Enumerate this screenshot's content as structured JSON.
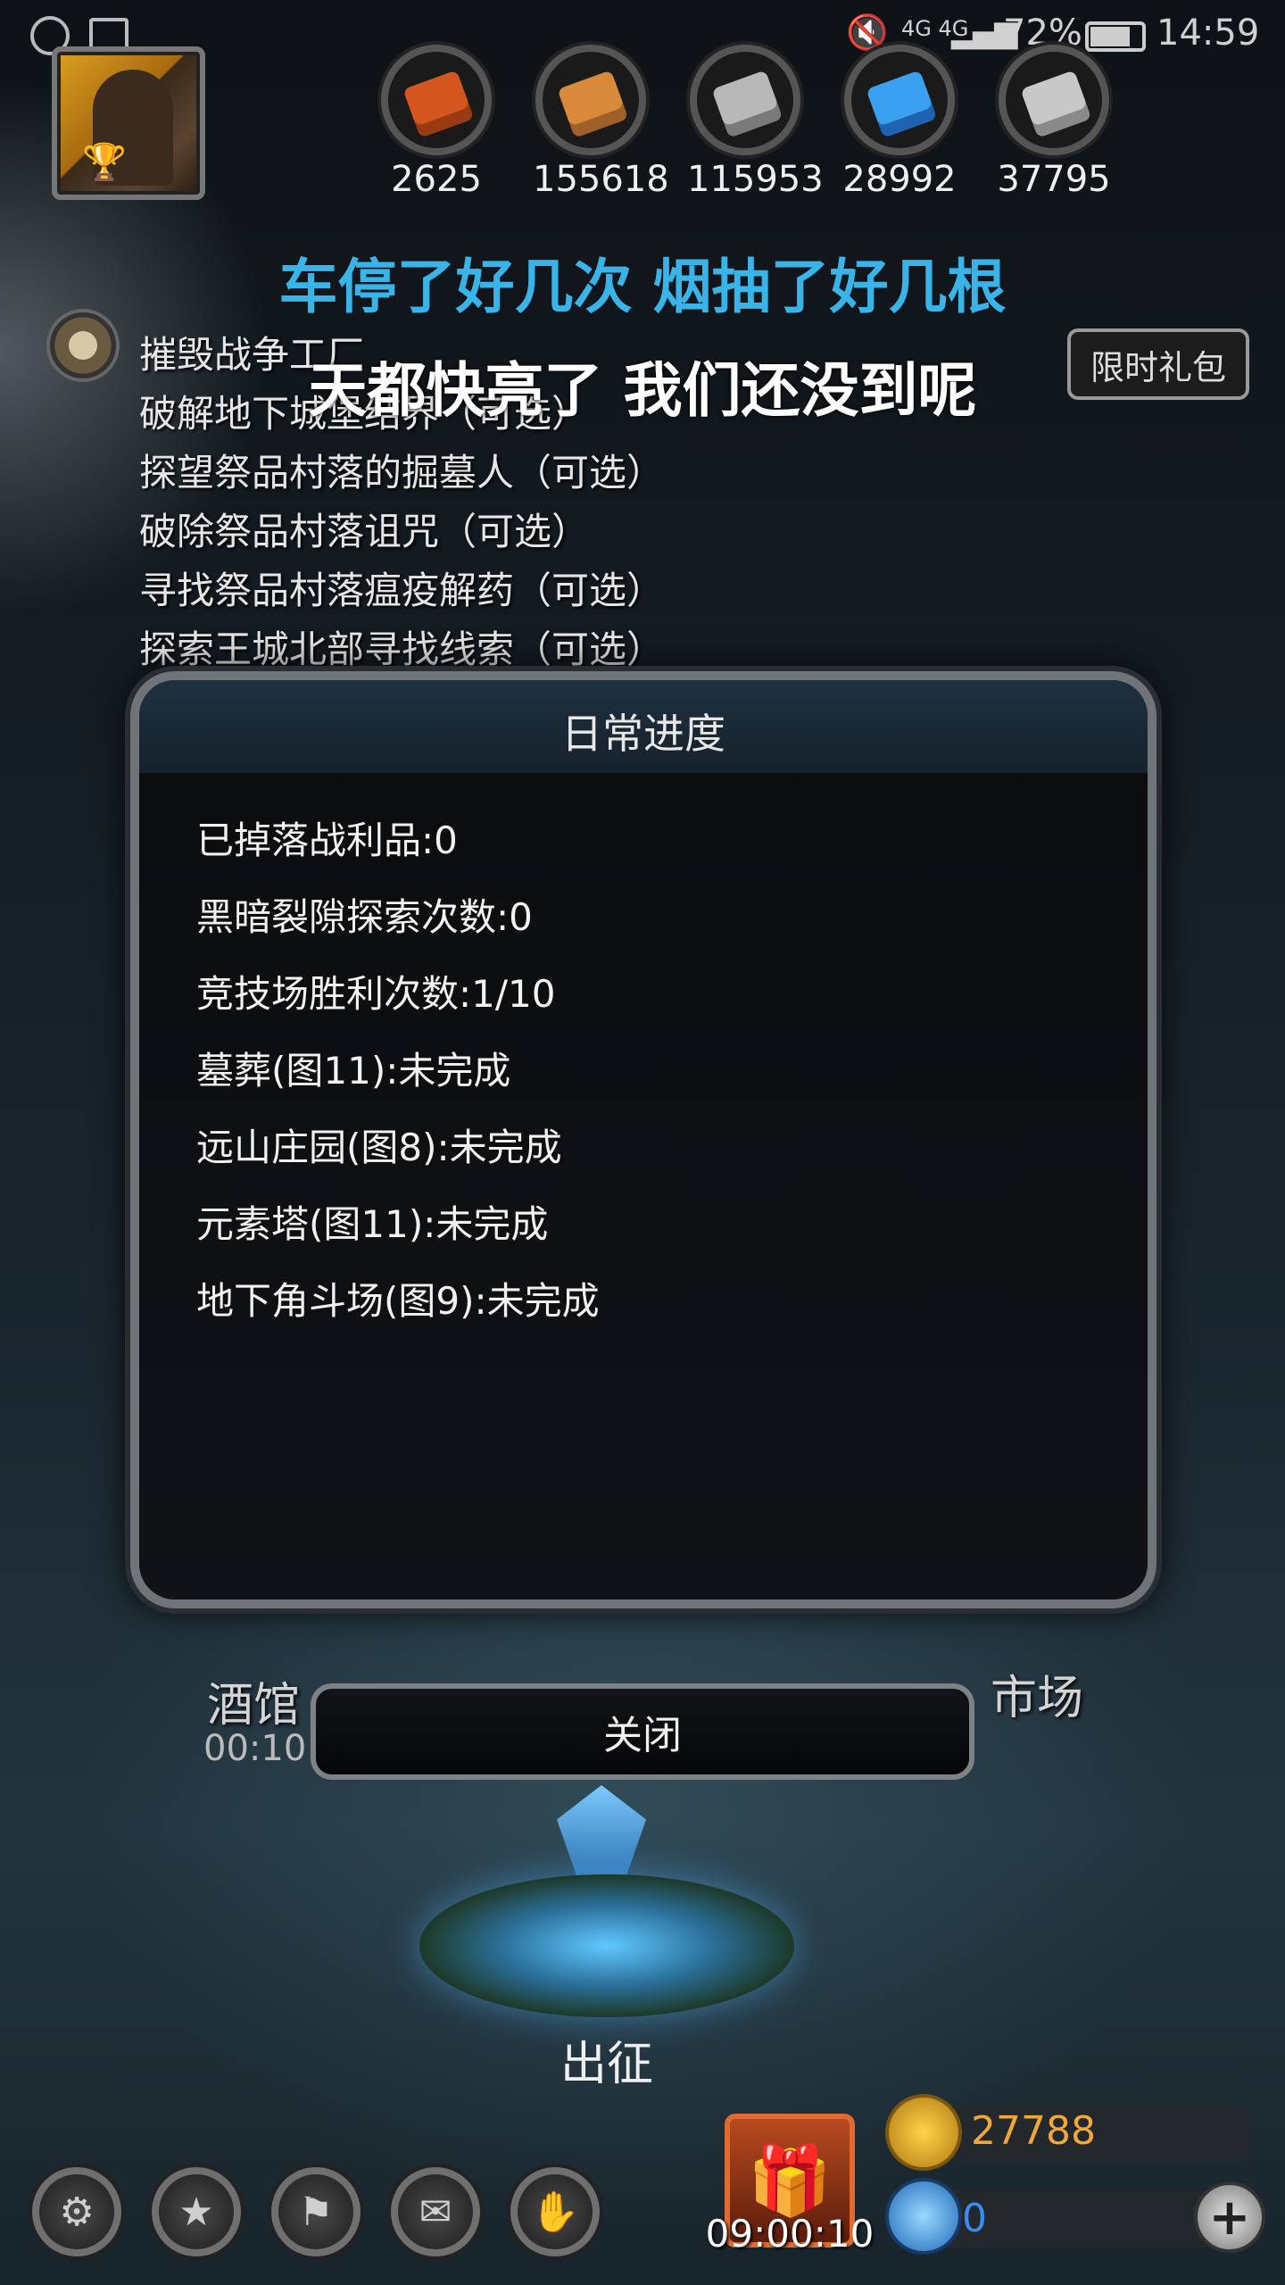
{
  "status_bar": {
    "network": "4G 4G",
    "battery": "72%",
    "time": "14:59"
  },
  "resources": [
    {
      "name": "meat-resource",
      "value": "2625",
      "color": "#d4561e",
      "color2": "#9a3a12"
    },
    {
      "name": "wood-resource",
      "value": "155618",
      "color": "#d88a3a",
      "color2": "#a0602a"
    },
    {
      "name": "iron-resource",
      "value": "115953",
      "color": "#b8b8b8",
      "color2": "#7a7a7a"
    },
    {
      "name": "crystal-resource",
      "value": "28992",
      "color": "#3aa0f0",
      "color2": "#1e62b0"
    },
    {
      "name": "stone-resource",
      "value": "37795",
      "color": "#c8c8c8",
      "color2": "#8a8a8a"
    }
  ],
  "lyrics": {
    "line1": "车停了好几次 烟抽了好几根",
    "line2": "天都快亮了 我们还没到呢"
  },
  "quests": [
    "摧毁战争工厂",
    "破解地下城堡结界（可选）",
    "探望祭品村落的掘墓人（可选）",
    "破除祭品村落诅咒（可选）",
    "寻找祭品村落瘟疫解药（可选）",
    "探索王城北部寻找线索（可选）"
  ],
  "gift_button": "限时礼包",
  "dialog": {
    "title": "日常进度",
    "items": [
      "已掉落战利品:0",
      "黑暗裂隙探索次数:0",
      "竞技场胜利次数:1/10",
      "墓葬(图11):未完成",
      "远山庄园(图8):未完成",
      "元素塔(图11):未完成",
      "地下角斗场(图9):未完成"
    ],
    "close_label": "关闭"
  },
  "locations": {
    "tavern": "酒馆",
    "tavern_timer": "00:10",
    "market": "市场",
    "expedition": "出征"
  },
  "bottom": {
    "gift_timer": "09:00:10",
    "gold": "27788",
    "gems": "0"
  }
}
